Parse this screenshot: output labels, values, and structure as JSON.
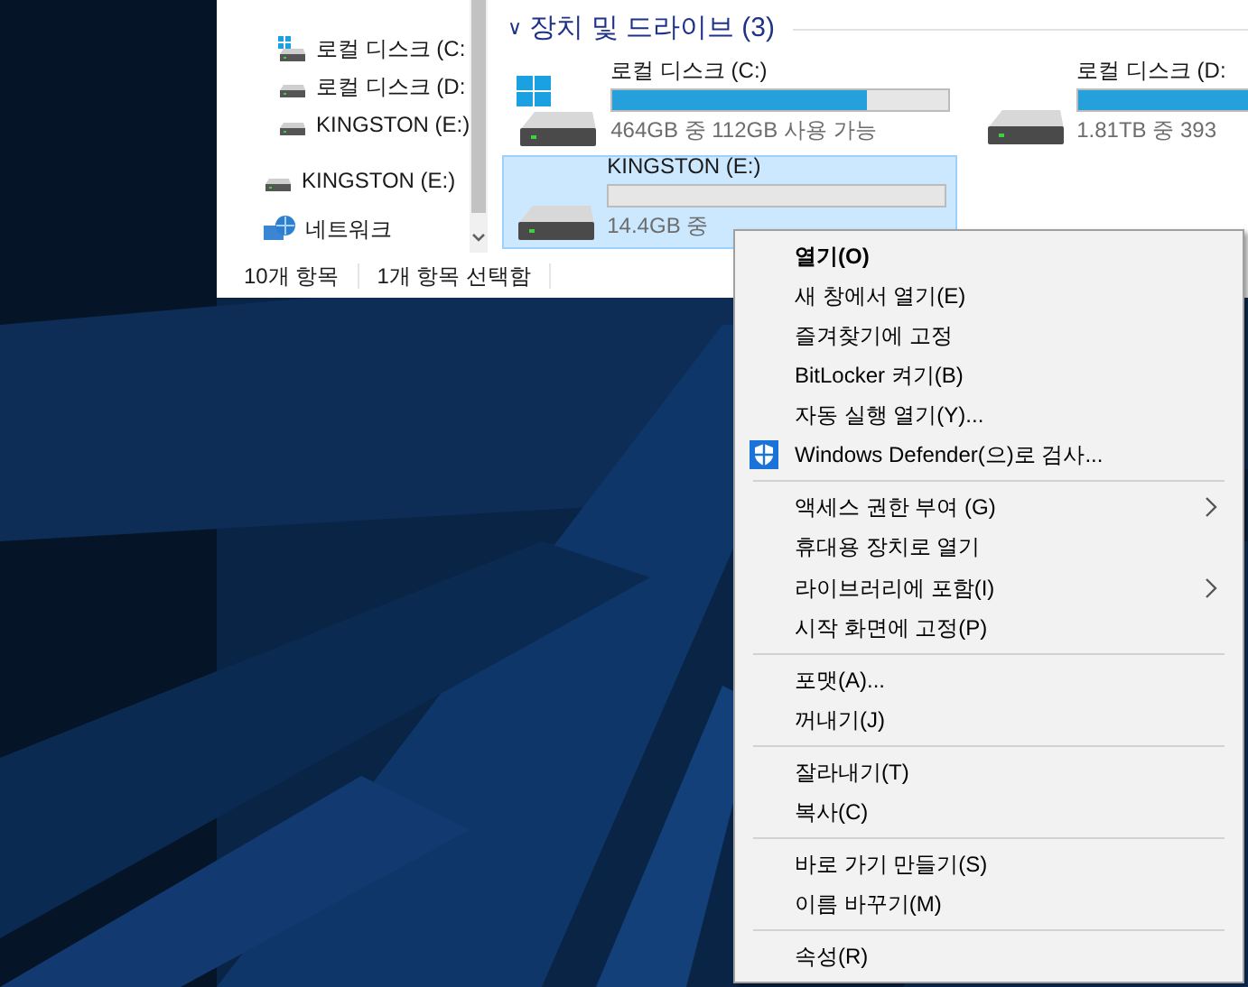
{
  "nav": {
    "pc_drives": [
      {
        "label": "로컬 디스크 (C:",
        "kind": "system"
      },
      {
        "label": "로컬 디스크 (D:",
        "kind": "drive"
      },
      {
        "label": "KINGSTON (E:)",
        "kind": "drive"
      }
    ],
    "items": [
      {
        "label": "KINGSTON (E:)",
        "kind": "drive"
      },
      {
        "label": "네트워크",
        "kind": "network"
      }
    ]
  },
  "section": {
    "chevron": "∨",
    "title": "장치 및 드라이브 (3)"
  },
  "drives": [
    {
      "name": "로컬 디스크 (C:)",
      "kind": "system",
      "level": 0.757,
      "free": "464GB 중 112GB 사용 가능",
      "selected": false
    },
    {
      "name": "로컬 디스크 (D:",
      "kind": "drive",
      "level": 0.9,
      "free": "1.81TB 중 393",
      "selected": false
    },
    {
      "name": "KINGSTON (E:)",
      "kind": "drive",
      "free": "14.4GB 중",
      "selected": true
    }
  ],
  "status_bar": [
    "10개 항목",
    "1개 항목 선택함"
  ],
  "context_menu": [
    [
      {
        "label": "열기(O)",
        "kind": "default"
      },
      {
        "label": "새 창에서 열기(E)",
        "kind": "plain"
      },
      {
        "label": "즐겨찾기에 고정",
        "kind": "plain"
      },
      {
        "label": "BitLocker 켜기(B)",
        "kind": "plain"
      },
      {
        "label": "자동 실행 열기(Y)...",
        "kind": "plain"
      },
      {
        "label": "Windows Defender(으)로 검사...",
        "kind": "shield"
      }
    ],
    [
      {
        "label": "액세스 권한 부여 (G)",
        "kind": "submenu"
      },
      {
        "label": "휴대용 장치로 열기",
        "kind": "plain"
      },
      {
        "label": "라이브러리에 포함(I)",
        "kind": "submenu"
      },
      {
        "label": "시작 화면에 고정(P)",
        "kind": "plain"
      }
    ],
    [
      {
        "label": "포맷(A)...",
        "kind": "plain"
      },
      {
        "label": "꺼내기(J)",
        "kind": "plain"
      }
    ],
    [
      {
        "label": "잘라내기(T)",
        "kind": "plain"
      },
      {
        "label": "복사(C)",
        "kind": "plain"
      }
    ],
    [
      {
        "label": "바로 가기 만들기(S)",
        "kind": "plain"
      },
      {
        "label": "이름 바꾸기(M)",
        "kind": "plain"
      }
    ],
    [
      {
        "label": "속성(R)",
        "kind": "plain"
      }
    ]
  ]
}
